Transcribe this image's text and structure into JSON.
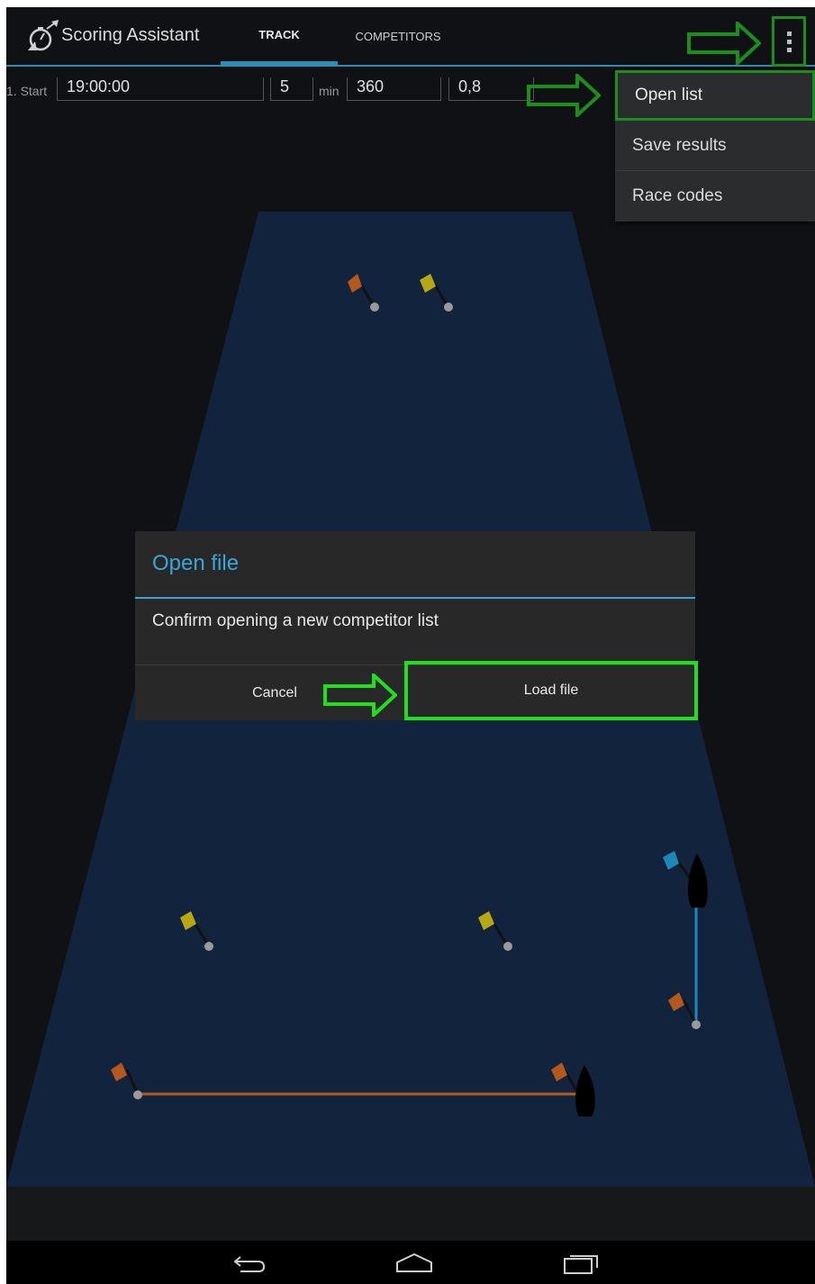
{
  "app": {
    "title": "Scoring Assistant",
    "icon": "stopwatch-flag-icon"
  },
  "tabs": [
    {
      "label": "TRACK",
      "selected": true
    },
    {
      "label": "COMPETITORS",
      "selected": false
    }
  ],
  "start_row": {
    "label": "1. Start",
    "time": "19:00:00",
    "interval": "5",
    "interval_unit": "min",
    "distance": "360",
    "factor": "0,8"
  },
  "overflow_menu": {
    "icon": "overflow-menu-icon",
    "items": [
      "Open list",
      "Save results",
      "Race codes"
    ]
  },
  "dialog": {
    "title": "Open file",
    "message": "Confirm opening a new competitor list",
    "cancel_label": "Cancel",
    "confirm_label": "Load file"
  },
  "annotations": {
    "highlight_color": "#22dd22"
  },
  "nav": {
    "back_icon": "back-icon",
    "home_icon": "home-icon",
    "recents_icon": "recent-apps-icon"
  },
  "colors": {
    "accent": "#2d8db3",
    "dialog_title": "#3aa6d8",
    "track_fill": "#12233d",
    "flag_orange": "#b5581d",
    "flag_yellow": "#b8a714",
    "flag_blue": "#1c88b8"
  }
}
